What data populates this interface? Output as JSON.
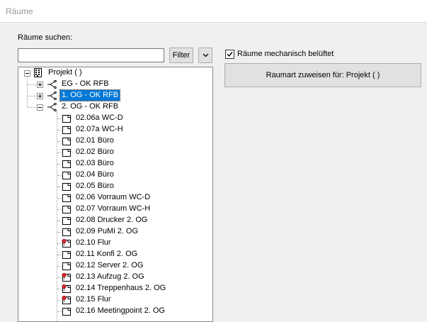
{
  "window": {
    "title": "Räume"
  },
  "search": {
    "label": "Räume suchen:",
    "value": "",
    "placeholder": "",
    "filter_label": "Filter"
  },
  "options": {
    "mech_vent_label": "Räume mechanisch belüftet",
    "mech_vent_checked": true
  },
  "assign": {
    "label": "Raumart zuweisen für: Projekt ( )"
  },
  "tree": {
    "root": {
      "label": "Projekt ( )",
      "icon": "building-icon"
    },
    "levels": [
      {
        "label": "EG - OK RFB",
        "expanded": false,
        "selected": false
      },
      {
        "label": "1. OG - OK RFB",
        "expanded": false,
        "selected": true
      },
      {
        "label": "2. OG - OK RFB",
        "expanded": true,
        "selected": false
      }
    ],
    "rooms": [
      {
        "label": "02.06a WC-D",
        "marker": false
      },
      {
        "label": "02.07a WC-H",
        "marker": false
      },
      {
        "label": "02.01 Büro",
        "marker": false
      },
      {
        "label": "02.02 Büro",
        "marker": false
      },
      {
        "label": "02.03 Büro",
        "marker": false
      },
      {
        "label": "02.04 Büro",
        "marker": false
      },
      {
        "label": "02.05 Büro",
        "marker": false
      },
      {
        "label": "02.06 Vorraum WC-D",
        "marker": false
      },
      {
        "label": "02.07 Vorraum WC-H",
        "marker": false
      },
      {
        "label": "02.08 Drucker 2. OG",
        "marker": false
      },
      {
        "label": "02.09 PuMi 2. OG",
        "marker": false
      },
      {
        "label": "02.10 Flur",
        "marker": true
      },
      {
        "label": "02.11 Konfi 2. OG",
        "marker": false
      },
      {
        "label": "02.12 Server 2. OG",
        "marker": false
      },
      {
        "label": "02.13 Aufzug 2. OG",
        "marker": true
      },
      {
        "label": "02.14 Treppenhaus 2. OG",
        "marker": true
      },
      {
        "label": "02.15 Flur",
        "marker": true
      },
      {
        "label": "02.16 Meetingpoint 2. OG",
        "marker": false
      }
    ]
  },
  "colors": {
    "selection": "#0078d7",
    "marker": "#d9262c"
  }
}
